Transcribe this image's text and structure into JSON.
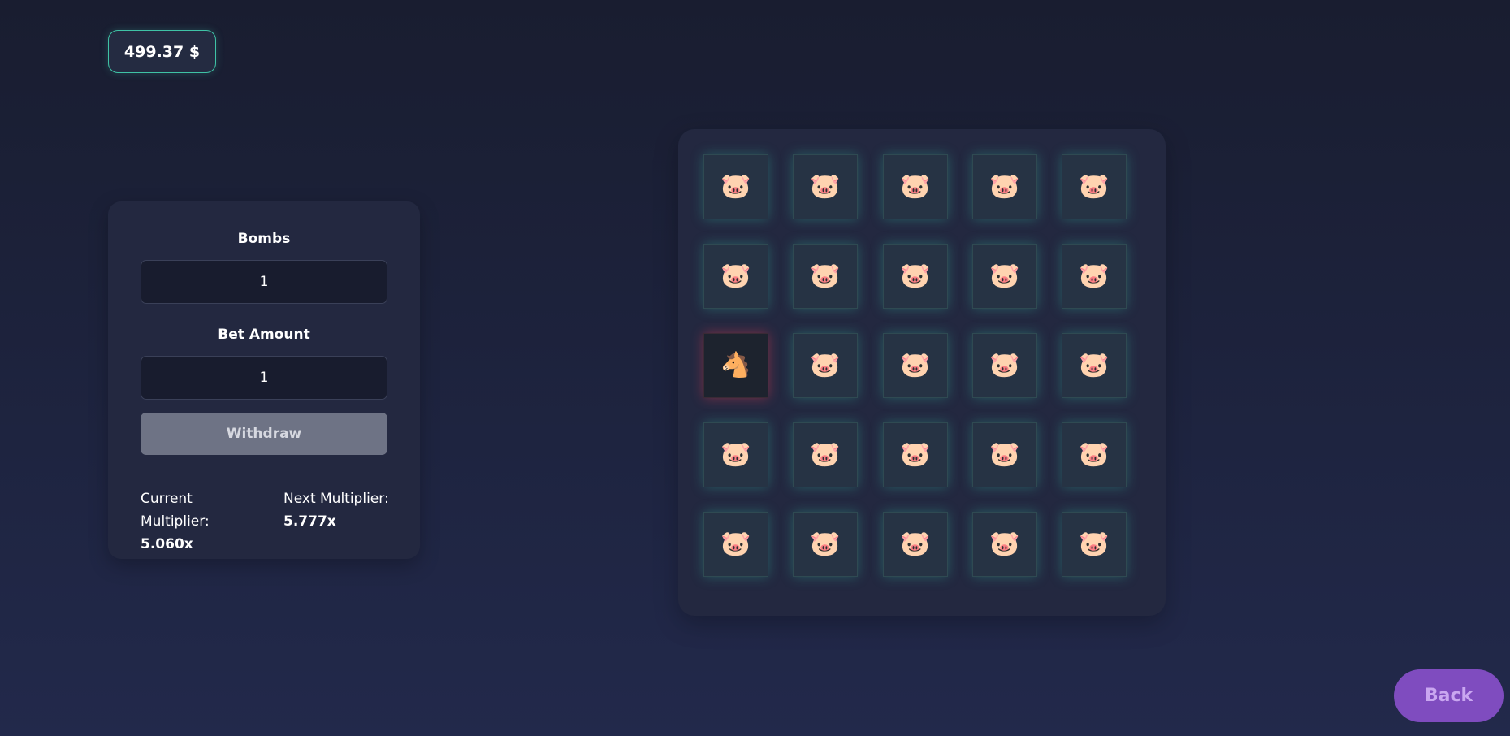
{
  "balance": {
    "label": "499.37 $"
  },
  "controls": {
    "bombs_label": "Bombs",
    "bombs_value": "1",
    "bet_label": "Bet Amount",
    "bet_value": "1",
    "withdraw_label": "Withdraw",
    "current_multiplier_label": "Current Multiplier:",
    "current_multiplier_value": "5.060x",
    "next_multiplier_label": "Next Multiplier:",
    "next_multiplier_value": "5.777x"
  },
  "board": {
    "rows": 5,
    "cols": 5,
    "tiles": [
      {
        "icon": "pig-face-icon",
        "glyph": "🐷",
        "state": "revealed-safe"
      },
      {
        "icon": "pig-face-icon",
        "glyph": "🐷",
        "state": "revealed-safe"
      },
      {
        "icon": "pig-face-icon",
        "glyph": "🐷",
        "state": "revealed-safe"
      },
      {
        "icon": "pig-face-icon",
        "glyph": "🐷",
        "state": "revealed-safe"
      },
      {
        "icon": "pig-face-icon",
        "glyph": "🐷",
        "state": "revealed-safe"
      },
      {
        "icon": "pig-face-icon",
        "glyph": "🐷",
        "state": "revealed-safe"
      },
      {
        "icon": "pig-face-icon",
        "glyph": "🐷",
        "state": "revealed-safe"
      },
      {
        "icon": "pig-face-icon",
        "glyph": "🐷",
        "state": "revealed-safe"
      },
      {
        "icon": "pig-face-icon",
        "glyph": "🐷",
        "state": "revealed-safe"
      },
      {
        "icon": "pig-face-icon",
        "glyph": "🐷",
        "state": "revealed-safe"
      },
      {
        "icon": "horse-head-icon",
        "glyph": "🐴",
        "state": "revealed-bomb"
      },
      {
        "icon": "pig-face-icon",
        "glyph": "🐷",
        "state": "revealed-safe"
      },
      {
        "icon": "pig-face-icon",
        "glyph": "🐷",
        "state": "revealed-safe"
      },
      {
        "icon": "pig-face-icon",
        "glyph": "🐷",
        "state": "revealed-safe"
      },
      {
        "icon": "pig-face-icon",
        "glyph": "🐷",
        "state": "revealed-safe"
      },
      {
        "icon": "pig-face-icon",
        "glyph": "🐷",
        "state": "revealed-safe"
      },
      {
        "icon": "pig-face-icon",
        "glyph": "🐷",
        "state": "revealed-safe"
      },
      {
        "icon": "pig-face-icon",
        "glyph": "🐷",
        "state": "revealed-safe"
      },
      {
        "icon": "pig-face-icon",
        "glyph": "🐷",
        "state": "revealed-safe"
      },
      {
        "icon": "pig-face-icon",
        "glyph": "🐷",
        "state": "revealed-safe"
      },
      {
        "icon": "pig-face-icon",
        "glyph": "🐷",
        "state": "revealed-safe"
      },
      {
        "icon": "pig-face-icon",
        "glyph": "🐷",
        "state": "revealed-safe"
      },
      {
        "icon": "pig-face-icon",
        "glyph": "🐷",
        "state": "revealed-safe"
      },
      {
        "icon": "pig-face-icon",
        "glyph": "🐷",
        "state": "revealed-safe"
      },
      {
        "icon": "pig-face-icon",
        "glyph": "🐷",
        "state": "revealed-safe"
      }
    ]
  },
  "back_button": {
    "label": "Back"
  },
  "colors": {
    "accent_teal": "#3fc3a6",
    "bomb_glow": "#e63c50",
    "back_purple": "#7f4cbf",
    "withdraw_disabled": "#6e7385"
  }
}
